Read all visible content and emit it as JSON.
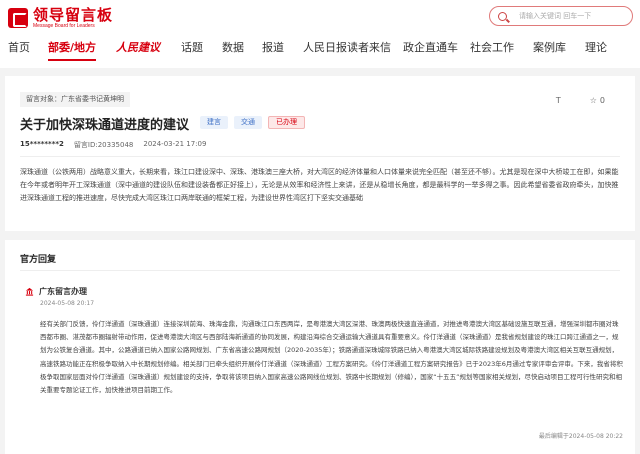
{
  "header": {
    "logo_cn": "领导留言板",
    "logo_en": "Message Board for Leaders",
    "search_placeholder": "请输入关键词 回车一下"
  },
  "nav": {
    "items": [
      "首页",
      "部委/地方",
      "人民建议",
      "话题",
      "数据",
      "报道",
      "人民日报读者来信",
      "政企直通车",
      "社会工作",
      "案例库",
      "理论"
    ]
  },
  "message": {
    "target_label": "留言对象：广东省委书记黄坤明",
    "title": "关于加快深珠通道进度的建议",
    "tags": [
      "建言",
      "交通",
      "已办理"
    ],
    "font_tool": "T",
    "like_count": "0",
    "author": "15********2",
    "id_text": "留言ID:20335048",
    "time": "2024-03-21 17:09",
    "body": "深珠通道（公铁两用）战略意义重大，长期来看，珠江口建设深中、深珠、港珠澳三座大桥，对大湾区的经济体量和人口体量来说完全匹配（甚至还不够）。尤其是现在深中大桥竣工在即，如果能在今年或者明年开工深珠通道（深中通道的建设队伍和建设装备都正好接上），无论是从效率和经济性上来讲，还是从稳增长角度，都是最科学的一举多得之事。因此希望省委省政府牵头，加快推进深珠通道工程的推进速度，尽快完成大湾区珠江口两岸联通的框架工程，为建设世界性湾区打下坚实交通基础"
  },
  "reply": {
    "heading": "官方回复",
    "org": "广东留言办理",
    "time": "2024-05-08 20:17",
    "body": "经有关部门反馈，伶仃洋通道（深珠通道）连接深圳前海、珠海金鼎，沟通珠江口东西两岸，是粤港澳大湾区深港、珠澳两极快速直连通道，对推进粤港澳大湾区基础设施互联互通，增强深圳都市圈对珠西都市圈、湛茂都市圈辐射带动作用，促进粤港澳大湾区与西部陆海新通道的协同发展，构建沿海综合交通运输大通道具有重要意义。伶仃洋通道（深珠通道）是我省规划建设的珠江口跨江通道之一，规划为公铁复合通道。其中，公路通道已纳入国家公路网规划、广东省高速公路网规划（2020-2035年）；铁路通道深珠城际铁路已纳入粤港澳大湾区城际铁路建设规划及粤港澳大湾区相关互联互通规划，高速铁路功能正在积极争取纳入中长期规划修编。相关部门已牵头组织开展伶仃洋通道（深珠通道）工程方案研究。《伶仃洋通道工程方案研究报告》已于2023年6月通过专家评审会评审。下来，我省将积极争取国家层面对伶仃洋通道（深珠通道）规划建设的支持，争取将该项目纳入国家高速公路网线位规划、铁路中长期规划（修编），国家“十五五”规划等国家相关规划，尽快启动项目工程可行性研究和相关重要专题论证工作，加快推进项目前期工作。",
    "footer": "最后编辑于2024-05-08 20:22"
  },
  "colors": {
    "brand_red": "#d7000f",
    "tag_blue": "#3d6fc5"
  }
}
